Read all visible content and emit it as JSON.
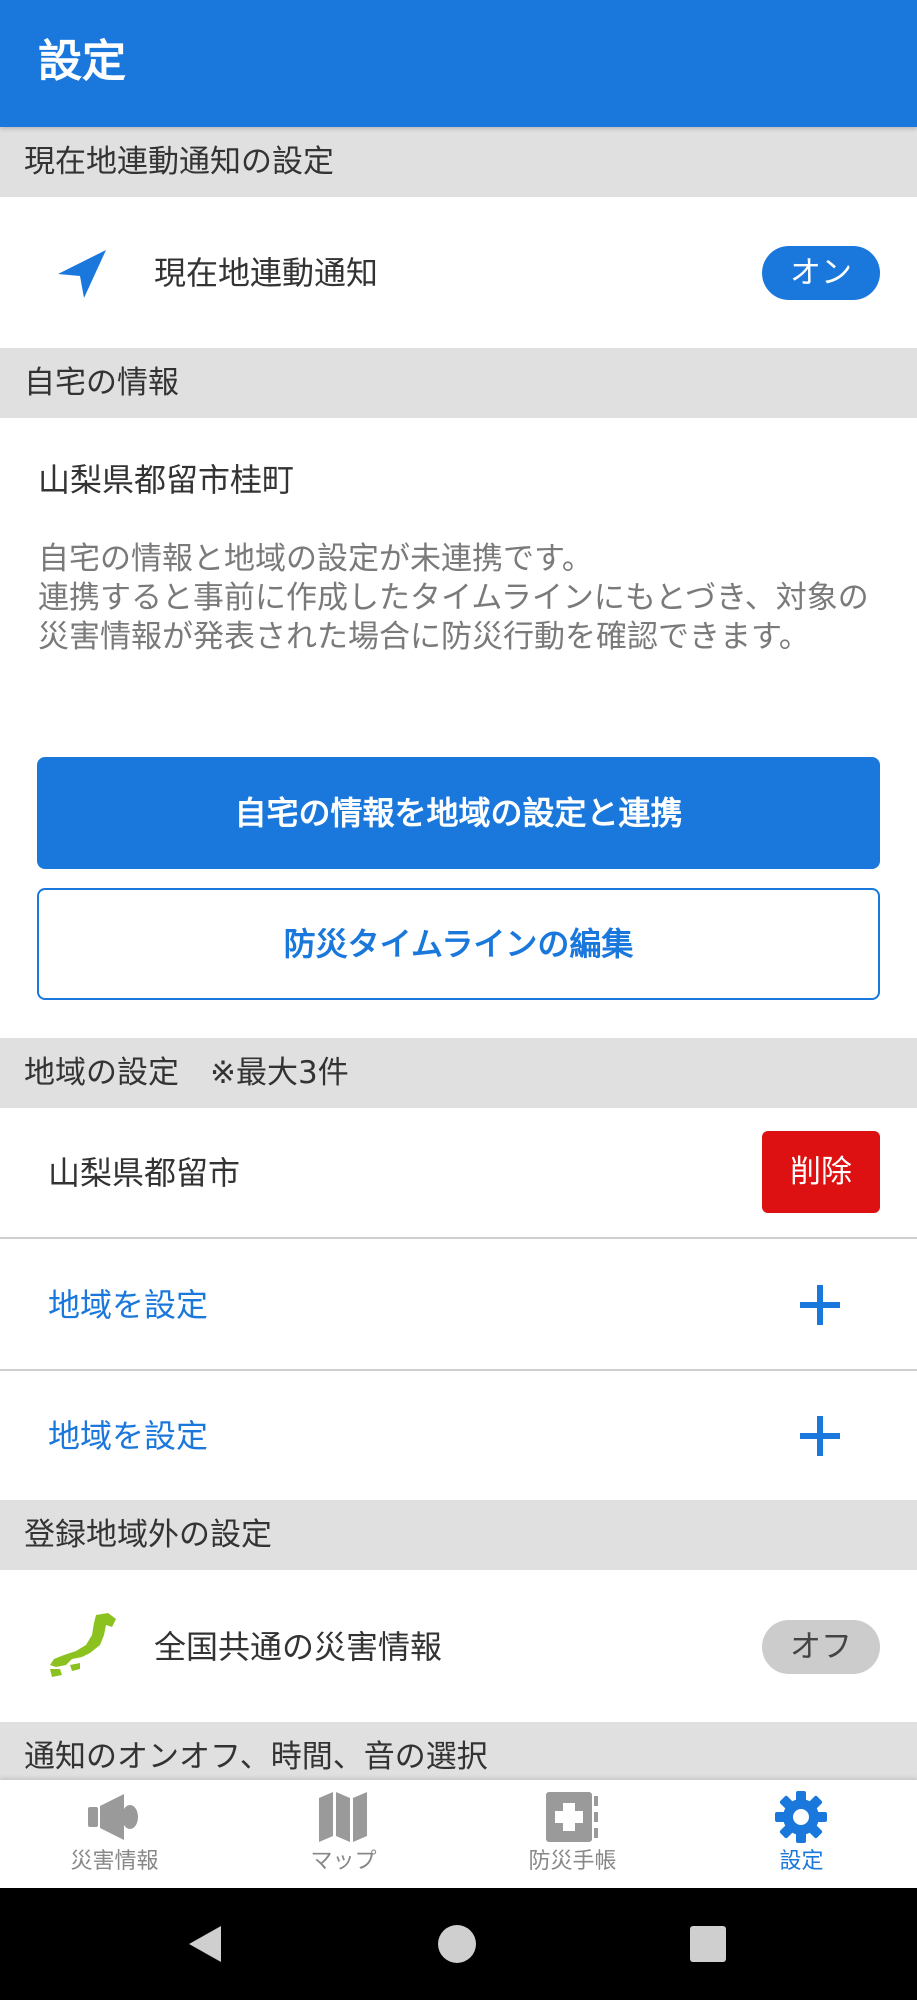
{
  "appbar": {
    "title": "設定"
  },
  "location_section": {
    "header": "現在地連動通知の設定",
    "item_label": "現在地連動通知",
    "toggle": "オン"
  },
  "home_section": {
    "header": "自宅の情報",
    "address": "山梨県都留市桂町",
    "description": "自宅の情報と地域の設定が未連携です。\n連携すると事前に作成したタイムラインにもとづき、対象の災害情報が発表された場合に防災行動を確認できます。",
    "link_button": "自宅の情報を地域の設定と連携",
    "edit_button": "防災タイムラインの編集"
  },
  "region_section": {
    "header": "地域の設定　※最大3件",
    "region": "山梨県都留市",
    "delete_button": "削除",
    "add_items": [
      "地域を設定",
      "地域を設定"
    ]
  },
  "outside_section": {
    "header": "登録地域外の設定",
    "item_label": "全国共通の災害情報",
    "toggle": "オフ"
  },
  "notify_section": {
    "header": "通知のオンオフ、時間、音の選択"
  },
  "bottom_nav": [
    {
      "label": "災害情報",
      "icon": "megaphone-icon"
    },
    {
      "label": "マップ",
      "icon": "map-icon"
    },
    {
      "label": "防災手帳",
      "icon": "handbook-icon"
    },
    {
      "label": "設定",
      "icon": "gear-icon"
    }
  ],
  "colors": {
    "accent": "#1a78dc",
    "delete": "#dd1111",
    "japan_map_green": "#8cc21f",
    "section_bg": "#e0e0e0"
  }
}
